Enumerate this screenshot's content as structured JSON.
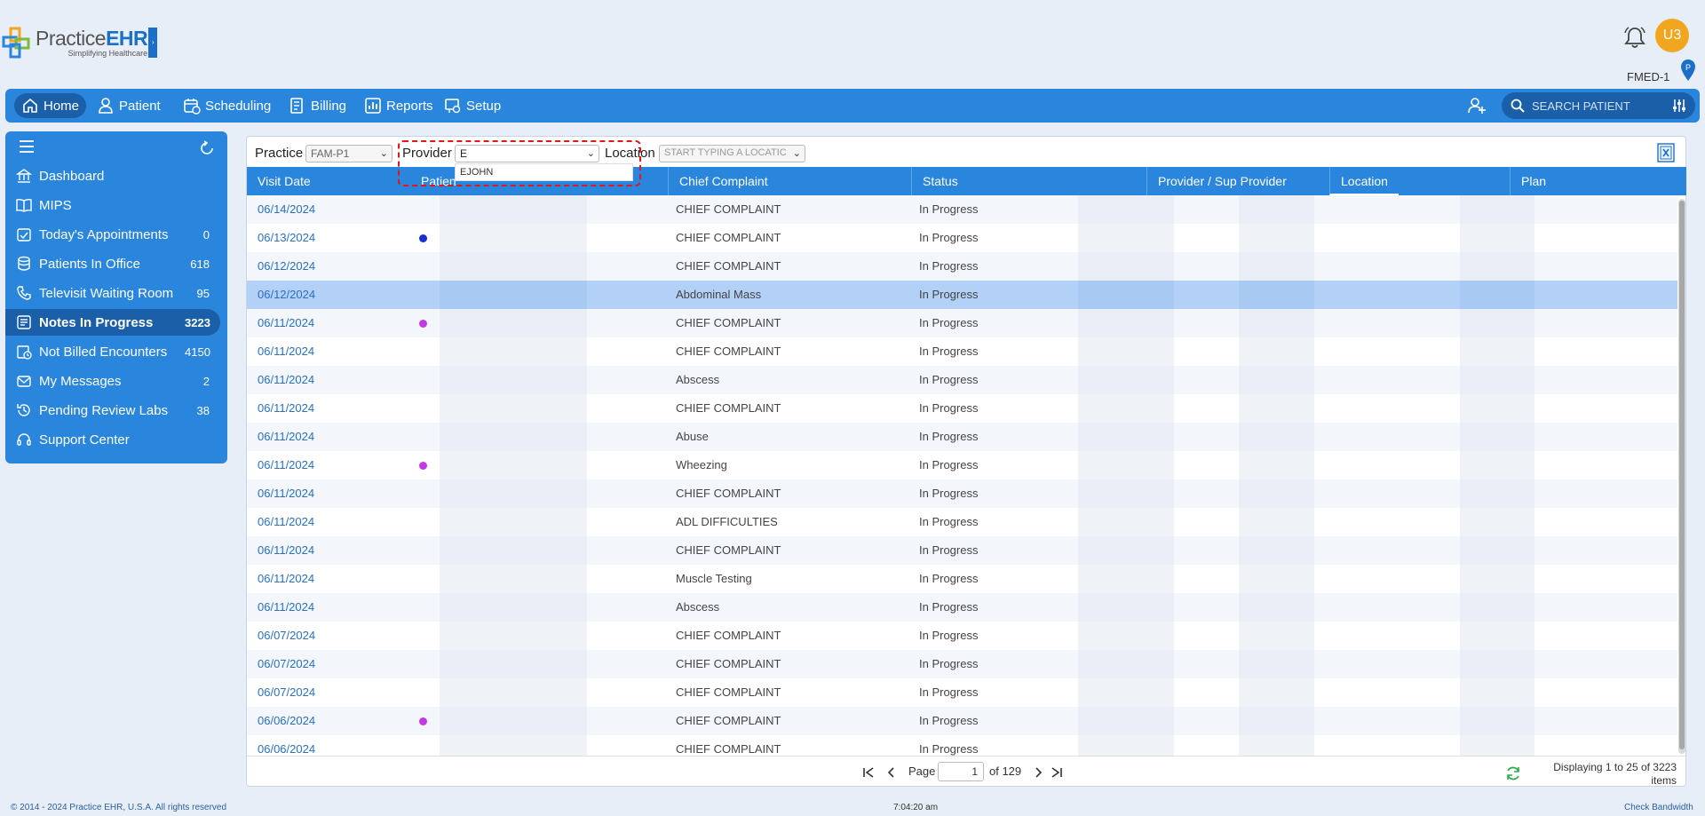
{
  "brand": {
    "name_plain": "Practice",
    "name_bold": "EHR",
    "tagline": "Simplifying Healthcare"
  },
  "header": {
    "avatar_initials": "U3",
    "facility": "FMED-1",
    "pin_letter": "P"
  },
  "nav": {
    "items": [
      {
        "label": "Home",
        "icon": "home-icon"
      },
      {
        "label": "Patient",
        "icon": "patient-icon"
      },
      {
        "label": "Scheduling",
        "icon": "calendar-icon"
      },
      {
        "label": "Billing",
        "icon": "billing-icon"
      },
      {
        "label": "Reports",
        "icon": "reports-icon"
      },
      {
        "label": "Setup",
        "icon": "setup-icon"
      }
    ],
    "search_placeholder": "SEARCH PATIENT"
  },
  "sidebar": {
    "items": [
      {
        "label": "Dashboard",
        "count": ""
      },
      {
        "label": "MIPS",
        "count": ""
      },
      {
        "label": "Today's Appointments",
        "count": "0"
      },
      {
        "label": "Patients In Office",
        "count": "618"
      },
      {
        "label": "Televisit Waiting Room",
        "count": "95"
      },
      {
        "label": "Notes In Progress",
        "count": "3223"
      },
      {
        "label": "Not Billed Encounters",
        "count": "4150"
      },
      {
        "label": "My Messages",
        "count": "2"
      },
      {
        "label": "Pending Review Labs",
        "count": "38"
      },
      {
        "label": "Support Center",
        "count": ""
      }
    ]
  },
  "filters": {
    "practice_label": "Practice",
    "practice_value": "FAM-P1",
    "provider_label": "Provider",
    "provider_value": "E",
    "provider_suggestion": "EJOHN",
    "location_label": "Location",
    "location_placeholder": "START TYPING A LOCATIC"
  },
  "table": {
    "columns": [
      "Visit Date",
      "Patien",
      "Chief Complaint",
      "Status",
      "Provider / Sup Provider",
      "Location",
      "Plan"
    ],
    "rows": [
      {
        "date": "06/14/2024",
        "cc": "CHIEF COMPLAINT",
        "status": "In Progress",
        "dot": ""
      },
      {
        "date": "06/13/2024",
        "cc": "CHIEF COMPLAINT",
        "status": "In Progress",
        "dot": "#1a2fd0"
      },
      {
        "date": "06/12/2024",
        "cc": "CHIEF COMPLAINT",
        "status": "In Progress",
        "dot": ""
      },
      {
        "date": "06/12/2024",
        "cc": "Abdominal Mass",
        "status": "In Progress",
        "dot": ""
      },
      {
        "date": "06/11/2024",
        "cc": "CHIEF COMPLAINT",
        "status": "In Progress",
        "dot": "#c23be0"
      },
      {
        "date": "06/11/2024",
        "cc": "CHIEF COMPLAINT",
        "status": "In Progress",
        "dot": ""
      },
      {
        "date": "06/11/2024",
        "cc": "Abscess",
        "status": "In Progress",
        "dot": ""
      },
      {
        "date": "06/11/2024",
        "cc": "CHIEF COMPLAINT",
        "status": "In Progress",
        "dot": ""
      },
      {
        "date": "06/11/2024",
        "cc": "Abuse",
        "status": "In Progress",
        "dot": ""
      },
      {
        "date": "06/11/2024",
        "cc": "Wheezing",
        "status": "In Progress",
        "dot": "#c23be0"
      },
      {
        "date": "06/11/2024",
        "cc": "CHIEF COMPLAINT",
        "status": "In Progress",
        "dot": ""
      },
      {
        "date": "06/11/2024",
        "cc": "ADL DIFFICULTIES",
        "status": "In Progress",
        "dot": ""
      },
      {
        "date": "06/11/2024",
        "cc": "CHIEF COMPLAINT",
        "status": "In Progress",
        "dot": ""
      },
      {
        "date": "06/11/2024",
        "cc": "Muscle Testing",
        "status": "In Progress",
        "dot": ""
      },
      {
        "date": "06/11/2024",
        "cc": "Abscess",
        "status": "In Progress",
        "dot": ""
      },
      {
        "date": "06/07/2024",
        "cc": "CHIEF COMPLAINT",
        "status": "In Progress",
        "dot": ""
      },
      {
        "date": "06/07/2024",
        "cc": "CHIEF COMPLAINT",
        "status": "In Progress",
        "dot": ""
      },
      {
        "date": "06/07/2024",
        "cc": "CHIEF COMPLAINT",
        "status": "In Progress",
        "dot": ""
      },
      {
        "date": "06/06/2024",
        "cc": "CHIEF COMPLAINT",
        "status": "In Progress",
        "dot": "#c23be0"
      },
      {
        "date": "06/06/2024",
        "cc": "CHIEF COMPLAINT",
        "status": "In Progress",
        "dot": ""
      }
    ],
    "selected_row": 3
  },
  "pager": {
    "page_label": "Page",
    "page_value": "1",
    "of_label": "of 129",
    "info": "Displaying 1 to 25 of 3223 items"
  },
  "footer": {
    "copyright": "© 2014 - 2024 Practice EHR, U.S.A. All rights reserved",
    "time": "7:04:20 am",
    "bandwidth": "Check Bandwidth"
  },
  "colors": {
    "primary": "#2a86dc",
    "primary_dark": "#1a5fa8",
    "avatar": "#f2a51f",
    "highlight": "#e01818",
    "link": "#2a6fbf"
  }
}
